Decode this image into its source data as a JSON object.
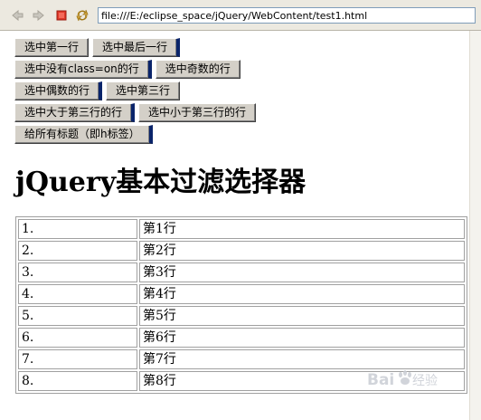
{
  "browser": {
    "address": "file:///E:/eclipse_space/jQuery/WebContent/test1.html",
    "buttons": [
      "back-icon",
      "forward-icon",
      "stop-icon",
      "refresh-icon"
    ]
  },
  "buttons": {
    "row1": [
      "选中第一行",
      "选中最后一行"
    ],
    "row2": [
      "选中没有class=on的行",
      "选中奇数的行"
    ],
    "row3": [
      "选中偶数的行",
      "选中第三行"
    ],
    "row4": [
      "选中大于第三行的行",
      "选中小于第三行的行"
    ],
    "row5": [
      "给所有标题（即h标签）"
    ]
  },
  "page": {
    "title": "jQuery基本过滤选择器"
  },
  "table": {
    "rows": [
      [
        "1.",
        "第1行"
      ],
      [
        "2.",
        "第2行"
      ],
      [
        "3.",
        "第3行"
      ],
      [
        "4.",
        "第4行"
      ],
      [
        "5.",
        "第5行"
      ],
      [
        "6.",
        "第6行"
      ],
      [
        "7.",
        "第7行"
      ],
      [
        "8.",
        "第8行"
      ]
    ]
  },
  "watermark": {
    "text": "Baidu经验"
  }
}
